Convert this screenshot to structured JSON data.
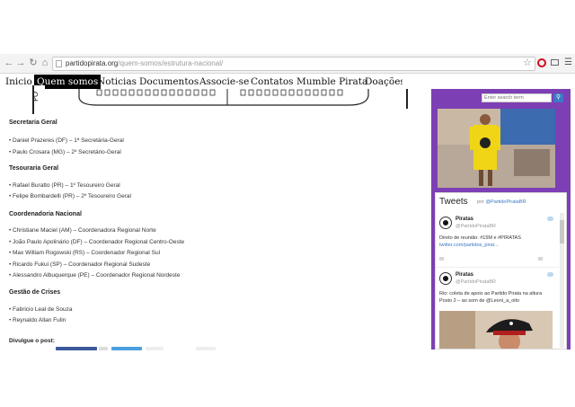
{
  "browser": {
    "url_host": "partidopirata.org",
    "url_path": "/quem-somos/estrutura-nacional/"
  },
  "nav": {
    "items": [
      "Inicio",
      "Quem somos",
      "Noticias",
      "Documentos",
      "Associe-se",
      "Contatos",
      "Mumble Pirata",
      "Doações"
    ],
    "active": "Quem somos"
  },
  "sidebar_tab": "PO",
  "sections": [
    {
      "title": "Secretaria Geral",
      "items": [
        "Daniel Prazeres (DF) – 1ª Secretária-Geral",
        "Paulo Crosara (MG) – 2º Secretário-Geral"
      ]
    },
    {
      "title": "Tesouraria Geral",
      "items": [
        "Rafael Buratto (PR) – 1º Tesoureiro Geral",
        "Felipe Bombardelli (PR) – 2º Tesoureiro Geral"
      ]
    },
    {
      "title": "Coordenadoria Nacional",
      "items": [
        "Christiane Maciel (AM) – Coordenadora Regional Norte",
        "João Paulo Apolinário (DF) – Coordenador Regional Centro-Oeste",
        "Max William Rogowski (RS) – Coordenador Regional Sul",
        "Ricardo Fukui (SP) – Coordenador Regional Sudeste",
        "Alessandro Albuquerque (PE) – Coordenador Regional Nordeste"
      ]
    },
    {
      "title": "Gestão de Crises",
      "items": [
        "Fabricio Leal de Souza",
        "Reynaldo Allan Fulin"
      ]
    }
  ],
  "share_label": "Divulgue o post:",
  "search": {
    "placeholder": "Enter search term"
  },
  "tweets": {
    "title": "Tweets",
    "by": "por",
    "by_handle": "@PartidoPirataBR",
    "items": [
      {
        "name": "Piratas",
        "handle": "@PartidoPirataBR",
        "text": [
          "Direto de reunião: #15M e #PIRATAS",
          "twitter.com/partidos_pirat..."
        ]
      },
      {
        "name": "Piratas",
        "handle": "@PartidoPirataBR",
        "text": [
          "Rio: coleta de apoio ao Partido Pirata na altura",
          "Posto 2 – ao som de @Leoni_a_oito"
        ]
      }
    ]
  },
  "colors": {
    "sidebar_purple": "#7d3fb4",
    "link_blue": "#3b78c6",
    "nav_active_bg": "#000000"
  }
}
